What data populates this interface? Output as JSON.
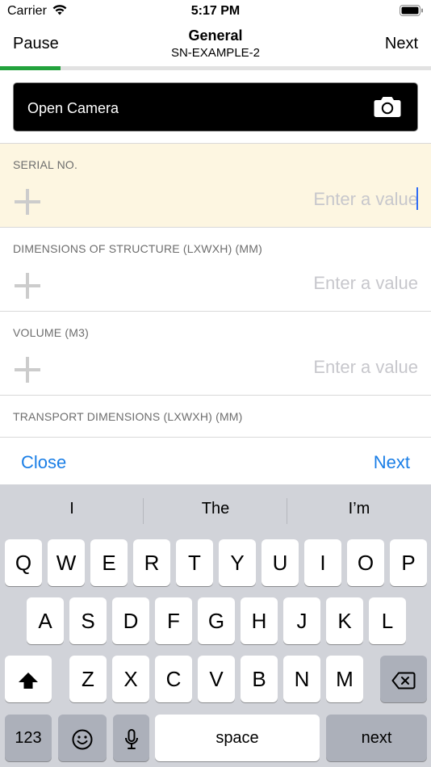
{
  "status_bar": {
    "carrier": "Carrier",
    "time": "5:17 PM"
  },
  "nav": {
    "left_label": "Pause",
    "title": "General",
    "subtitle": "SN-EXAMPLE-2",
    "right_label": "Next",
    "progress_fraction": 0.14,
    "progress_color": "#23a23c"
  },
  "camera": {
    "label": "Open Camera",
    "icon": "camera-icon"
  },
  "fields": [
    {
      "label": "SERIAL NO.",
      "placeholder": "Enter a value",
      "value": "",
      "active": true
    },
    {
      "label": "DIMENSIONS OF STRUCTURE (LXWXH) (MM)",
      "placeholder": "Enter a value",
      "value": "",
      "active": false
    },
    {
      "label": "VOLUME (M3)",
      "placeholder": "Enter a value",
      "value": "",
      "active": false
    },
    {
      "label": "TRANSPORT DIMENSIONS (LXWXH) (MM)",
      "placeholder": "",
      "value": "",
      "active": false
    }
  ],
  "accessory": {
    "close_label": "Close",
    "next_label": "Next"
  },
  "keyboard": {
    "suggestions": [
      "I",
      "The",
      "I’m"
    ],
    "row1": [
      "Q",
      "W",
      "E",
      "R",
      "T",
      "Y",
      "U",
      "I",
      "O",
      "P"
    ],
    "row2": [
      "A",
      "S",
      "D",
      "F",
      "G",
      "H",
      "J",
      "K",
      "L"
    ],
    "row3": [
      "Z",
      "X",
      "C",
      "V",
      "B",
      "N",
      "M"
    ],
    "numbers_label": "123",
    "space_label": "space",
    "return_label": "next",
    "icons": {
      "shift": "shift-icon",
      "delete": "delete-icon",
      "emoji": "emoji-icon",
      "mic": "mic-icon"
    }
  },
  "colors": {
    "accent": "#1a7ee6",
    "active_field_bg": "#fdf6e1",
    "keyboard_bg": "#d1d3d9"
  }
}
